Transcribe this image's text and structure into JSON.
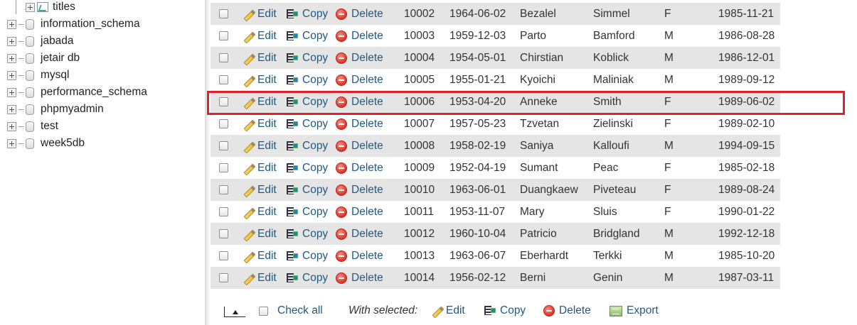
{
  "sidebar": {
    "top_item": {
      "label": "titles",
      "icon": "table-icon"
    },
    "databases": [
      {
        "label": "information_schema"
      },
      {
        "label": "jabada"
      },
      {
        "label": "jetair db"
      },
      {
        "label": "mysql"
      },
      {
        "label": "performance_schema"
      },
      {
        "label": "phpmyadmin"
      },
      {
        "label": "test"
      },
      {
        "label": "week5db"
      }
    ]
  },
  "actions": {
    "edit": "Edit",
    "copy": "Copy",
    "delete": "Delete"
  },
  "rows": [
    {
      "emp_no": "10002",
      "birth_date": "1964-06-02",
      "first_name": "Bezalel",
      "last_name": "Simmel",
      "gender": "F",
      "hire_date": "1985-11-21"
    },
    {
      "emp_no": "10003",
      "birth_date": "1959-12-03",
      "first_name": "Parto",
      "last_name": "Bamford",
      "gender": "M",
      "hire_date": "1986-08-28"
    },
    {
      "emp_no": "10004",
      "birth_date": "1954-05-01",
      "first_name": "Chirstian",
      "last_name": "Koblick",
      "gender": "M",
      "hire_date": "1986-12-01"
    },
    {
      "emp_no": "10005",
      "birth_date": "1955-01-21",
      "first_name": "Kyoichi",
      "last_name": "Maliniak",
      "gender": "M",
      "hire_date": "1989-09-12"
    },
    {
      "emp_no": "10006",
      "birth_date": "1953-04-20",
      "first_name": "Anneke",
      "last_name": "Smith",
      "gender": "F",
      "hire_date": "1989-06-02"
    },
    {
      "emp_no": "10007",
      "birth_date": "1957-05-23",
      "first_name": "Tzvetan",
      "last_name": "Zielinski",
      "gender": "F",
      "hire_date": "1989-02-10"
    },
    {
      "emp_no": "10008",
      "birth_date": "1958-02-19",
      "first_name": "Saniya",
      "last_name": "Kalloufi",
      "gender": "M",
      "hire_date": "1994-09-15"
    },
    {
      "emp_no": "10009",
      "birth_date": "1952-04-19",
      "first_name": "Sumant",
      "last_name": "Peac",
      "gender": "F",
      "hire_date": "1985-02-18"
    },
    {
      "emp_no": "10010",
      "birth_date": "1963-06-01",
      "first_name": "Duangkaew",
      "last_name": "Piveteau",
      "gender": "F",
      "hire_date": "1989-08-24"
    },
    {
      "emp_no": "10011",
      "birth_date": "1953-11-07",
      "first_name": "Mary",
      "last_name": "Sluis",
      "gender": "F",
      "hire_date": "1990-01-22"
    },
    {
      "emp_no": "10012",
      "birth_date": "1960-10-04",
      "first_name": "Patricio",
      "last_name": "Bridgland",
      "gender": "M",
      "hire_date": "1992-12-18"
    },
    {
      "emp_no": "10013",
      "birth_date": "1963-06-07",
      "first_name": "Eberhardt",
      "last_name": "Terkki",
      "gender": "M",
      "hire_date": "1985-10-20"
    },
    {
      "emp_no": "10014",
      "birth_date": "1956-02-12",
      "first_name": "Berni",
      "last_name": "Genin",
      "gender": "M",
      "hire_date": "1987-03-11"
    }
  ],
  "highlighted_row_emp_no": "10006",
  "footer": {
    "check_all": "Check all",
    "with_selected": "With selected:",
    "edit": "Edit",
    "copy": "Copy",
    "delete": "Delete",
    "export": "Export"
  },
  "colors": {
    "link": "#235a81",
    "row_alt": "#e5e5e5",
    "highlight_border": "#e0202a"
  }
}
